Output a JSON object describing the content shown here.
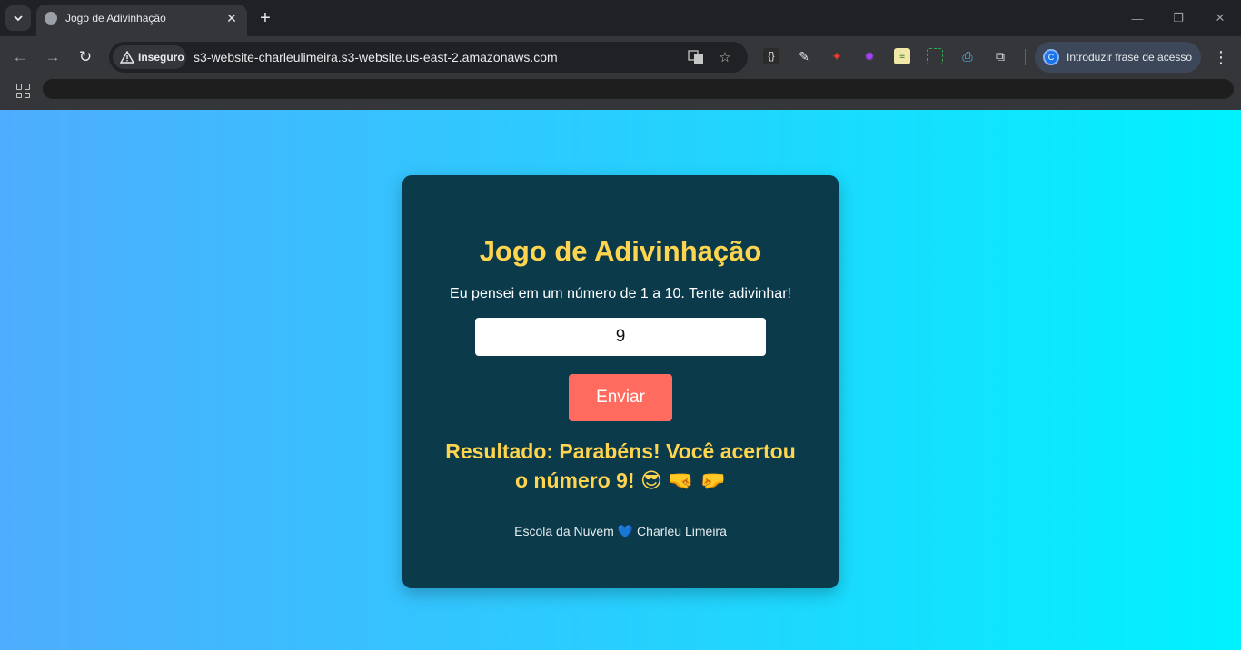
{
  "browser": {
    "tab": {
      "title": "Jogo de Adivinhação"
    },
    "omnibox": {
      "security_label": "Inseguro",
      "url": "s3-website-charleulimeira.s3-website.us-east-2.amazonaws.com"
    },
    "profile": {
      "initial": "C",
      "label": "Introduzir frase de acesso"
    },
    "icons": {
      "tab_search": "chevron-down-icon",
      "favicon": "globe-icon",
      "back": "arrow-left-icon",
      "forward": "arrow-right-icon",
      "reload": "reload-icon",
      "warning": "warning-icon",
      "translate": "translate-icon",
      "bookmark": "star-icon",
      "menu": "kebab-menu-icon",
      "apps": "apps-grid-icon"
    }
  },
  "page": {
    "title": "Jogo de Adivinhação",
    "instructions": "Eu pensei em um número de 1 a 10. Tente adivinhar!",
    "guess_value": "9",
    "submit_label": "Enviar",
    "result": "Resultado: Parabéns! Você acertou o número 9! 😎 🤜 🤛",
    "footer": "Escola da Nuvem 💙 Charleu Limeira",
    "colors": {
      "background_start": "#4facfe",
      "background_end": "#00f2fe",
      "card": "#0b3a4b",
      "accent_yellow": "#ffd54f",
      "button": "#ff6b5e"
    }
  }
}
